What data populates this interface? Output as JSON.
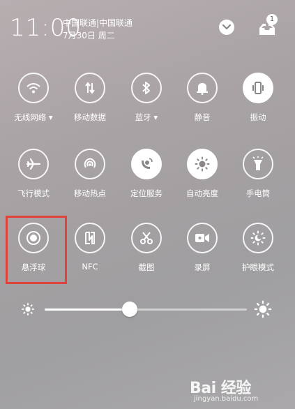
{
  "status_bar": {
    "time": "11:00",
    "carrier": "中国联通|中国联通",
    "date": "7月30日 周二",
    "notification_count": "1"
  },
  "tiles": [
    {
      "label": "无线网络 ▾",
      "icon": "wifi-icon",
      "active": false
    },
    {
      "label": "移动数据",
      "icon": "mobile-data-icon",
      "active": false
    },
    {
      "label": "蓝牙 ▾",
      "icon": "bluetooth-icon",
      "active": false
    },
    {
      "label": "静音",
      "icon": "bell-icon",
      "active": false
    },
    {
      "label": "振动",
      "icon": "vibrate-icon",
      "active": true
    },
    {
      "label": "飞行模式",
      "icon": "airplane-icon",
      "active": false
    },
    {
      "label": "移动热点",
      "icon": "hotspot-icon",
      "active": false
    },
    {
      "label": "定位服务",
      "icon": "location-icon",
      "active": true
    },
    {
      "label": "自动亮度",
      "icon": "auto-brightness-icon",
      "active": true
    },
    {
      "label": "手电筒",
      "icon": "flashlight-icon",
      "active": false
    },
    {
      "label": "悬浮球",
      "icon": "floating-ball-icon",
      "active": false
    },
    {
      "label": "NFC",
      "icon": "nfc-icon",
      "active": false
    },
    {
      "label": "截图",
      "icon": "scissors-icon",
      "active": false
    },
    {
      "label": "录屏",
      "icon": "record-screen-icon",
      "active": false
    },
    {
      "label": "护眼模式",
      "icon": "eye-care-icon",
      "active": false
    }
  ],
  "brightness": {
    "level": 0.42
  },
  "watermark": {
    "brand": "Bai 经验",
    "url": "jingyan.baidu.com"
  },
  "colors": {
    "highlight": "#e0423c",
    "active_tile": "#ffffff",
    "icon_dark": "#8a8688"
  }
}
